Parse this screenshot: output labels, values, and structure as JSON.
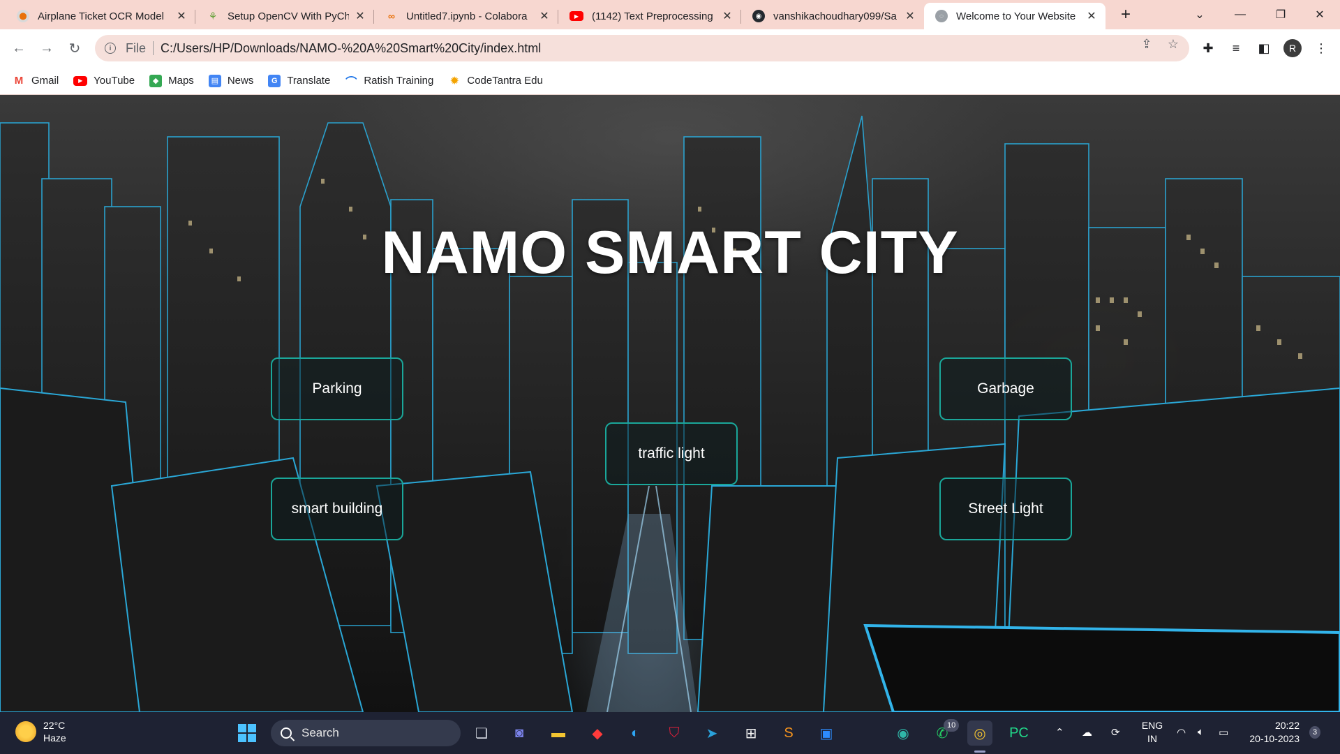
{
  "browser": {
    "tabs": [
      {
        "title": "Airplane Ticket OCR Model",
        "icon": "colab-icon",
        "color": "#e8710a"
      },
      {
        "title": "Setup OpenCV With PyCha",
        "icon": "opencv-icon",
        "color": "#5c9e31"
      },
      {
        "title": "Untitled7.ipynb - Colabora",
        "icon": "colab-icon",
        "color": "#e8710a"
      },
      {
        "title": "(1142) Text Preprocessing |",
        "icon": "youtube-icon",
        "color": "#ff0000"
      },
      {
        "title": "vanshikachoudhary099/Sa",
        "icon": "github-icon",
        "color": "#24292f"
      },
      {
        "title": "Welcome to Your Website",
        "icon": "globe-icon",
        "color": "#9aa0a6"
      }
    ],
    "new_tab_glyph": "+",
    "scheme_label": "File",
    "url": "C:/Users/HP/Downloads/NAMO-%20A%20Smart%20City/index.html",
    "profile_initial": "R",
    "bookmarks": [
      {
        "label": "Gmail",
        "icon": "gmail-icon",
        "color": "#ea4335"
      },
      {
        "label": "YouTube",
        "icon": "youtube-icon",
        "color": "#ff0000"
      },
      {
        "label": "Maps",
        "icon": "maps-icon",
        "color": "#34a853"
      },
      {
        "label": "News",
        "icon": "news-icon",
        "color": "#4285f4"
      },
      {
        "label": "Translate",
        "icon": "translate-icon",
        "color": "#4285f4"
      },
      {
        "label": "Ratish Training",
        "icon": "ratish-icon",
        "color": "#1a73e8"
      },
      {
        "label": "CodeTantra Edu",
        "icon": "codetantra-icon",
        "color": "#f4a300"
      }
    ]
  },
  "page": {
    "title": "NAMO SMART CITY",
    "buttons": {
      "parking": "Parking",
      "garbage": "Garbage",
      "traffic_light": "traffic light",
      "smart_building": "smart building",
      "street_light": "Street Light"
    },
    "accent_color": "#1aa79a"
  },
  "taskbar": {
    "weather_temp": "22°C",
    "weather_desc": "Haze",
    "search_placeholder": "Search",
    "whatsapp_badge": "10",
    "lang_line1": "ENG",
    "lang_line2": "IN",
    "time": "20:22",
    "date": "20-10-2023",
    "notification_count": "3"
  }
}
